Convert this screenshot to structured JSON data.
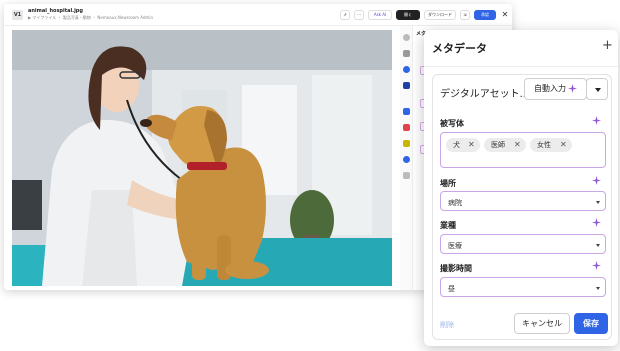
{
  "colors": {
    "accent": "#2f64e6",
    "ai_purple": "#8e5ad6",
    "field_border": "#c9a6e6"
  },
  "background_window": {
    "version_badge": "V1",
    "file_name": "animal_hospital.jpg",
    "file_path": "▶ マイファイル ・ 製品写真・動物 ・ Nemeaux Newsroom Admin",
    "buttons": {
      "ask_ai": "Ask AI",
      "open": "開く",
      "download": "ダウンロード",
      "approve": "承認"
    },
    "metadata_title": "メタデータ",
    "photo_icon": "dog-veterinarian-photo"
  },
  "panel": {
    "title": "メタデータ",
    "asset_name": "デジタルアセット...",
    "auto_fill_label": "自動入力",
    "fields": {
      "subject": {
        "label": "被写体",
        "tags": [
          "犬",
          "医師",
          "女性"
        ]
      },
      "location": {
        "label": "場所",
        "value": "病院"
      },
      "industry": {
        "label": "業種",
        "value": "医療"
      },
      "shooting_time": {
        "label": "撮影時間",
        "value": "昼"
      }
    },
    "footer": {
      "delete_label": "削除",
      "cancel_label": "キャンセル",
      "save_label": "保存"
    }
  }
}
